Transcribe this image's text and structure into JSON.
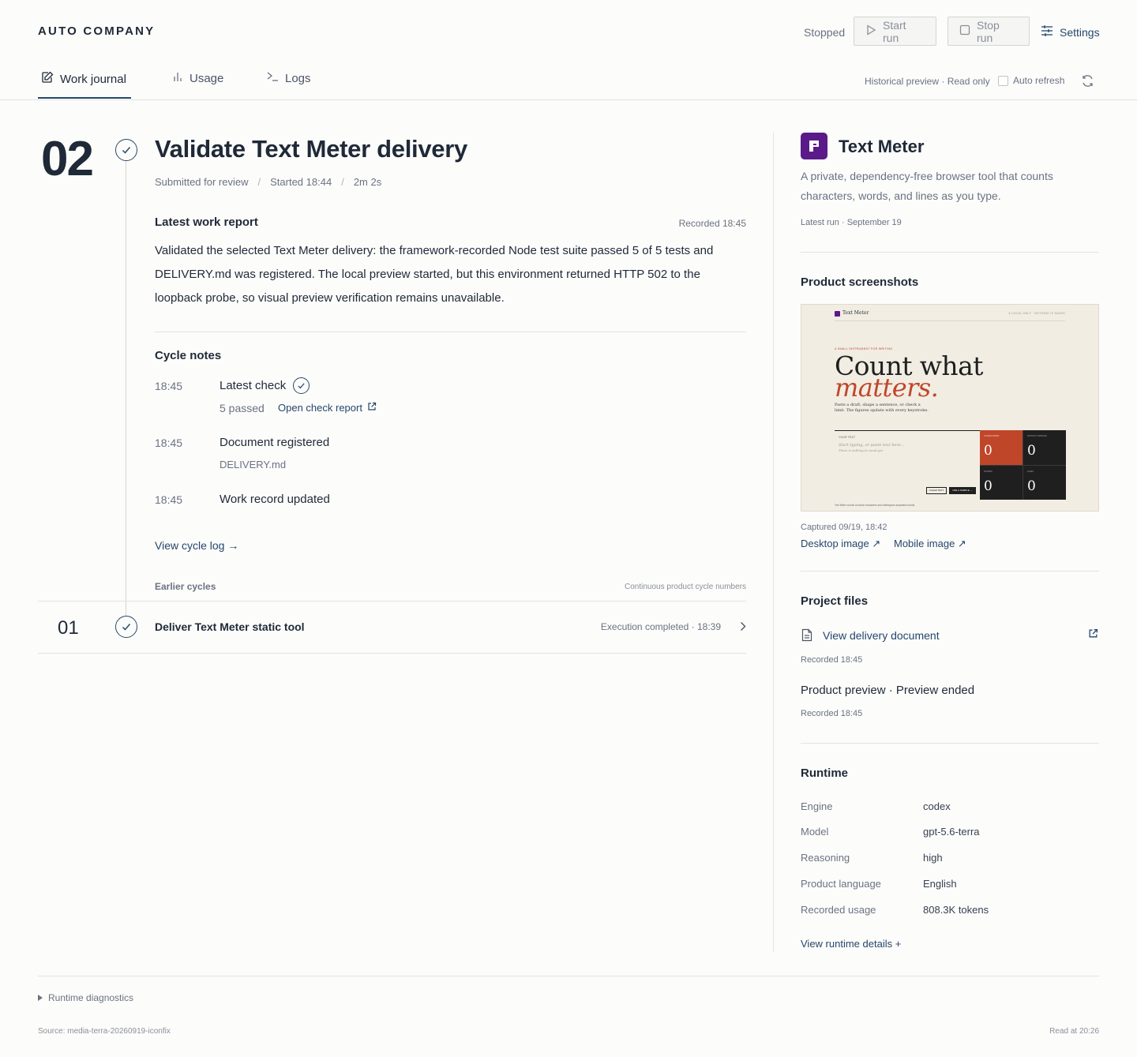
{
  "header": {
    "brand": "AUTO COMPANY",
    "status": "Stopped",
    "start_label": "Start run",
    "stop_label": "Stop run",
    "settings_label": "Settings"
  },
  "tabs": [
    {
      "label": "Work journal",
      "active": true
    },
    {
      "label": "Usage",
      "active": false
    },
    {
      "label": "Logs",
      "active": false
    }
  ],
  "toolbar": {
    "mode": "Historical preview · Read only",
    "auto_refresh_label": "Auto refresh",
    "auto_refresh_checked": false
  },
  "cycle": {
    "number": "02",
    "title": "Validate Text Meter delivery",
    "meta": [
      "Submitted for review",
      "Started 18:44",
      "2m 2s"
    ],
    "report_heading": "Latest work report",
    "report_recorded": "Recorded 18:45",
    "report_text": "Validated the selected Text Meter delivery: the framework-recorded Node test suite passed 5 of 5 tests and DELIVERY.md was registered. The local preview started, but this environment returned HTTP 502 to the loopback probe, so visual preview verification remains unavailable.",
    "notes_heading": "Cycle notes",
    "notes": [
      {
        "time": "18:45",
        "title": "Latest check",
        "sub": "5 passed",
        "link": "Open check report"
      },
      {
        "time": "18:45",
        "title": "Document registered",
        "sub": "DELIVERY.md"
      },
      {
        "time": "18:45",
        "title": "Work record updated"
      }
    ],
    "cycle_log_link": "View cycle log →"
  },
  "earlier": {
    "heading": "Earlier cycles",
    "note": "Continuous product cycle numbers",
    "items": [
      {
        "number": "01",
        "title": "Deliver Text Meter static tool",
        "status": "Execution completed · 18:39"
      }
    ]
  },
  "product": {
    "name": "Text Meter",
    "description": "A private, dependency-free browser tool that counts characters, words, and lines as you type.",
    "latest_run": "Latest run · September 19",
    "accent": "#5b1a8a"
  },
  "screenshots": {
    "heading": "Product screenshots",
    "captured": "Captured 09/19, 18:42",
    "desktop_link": "Desktop image ↗",
    "mobile_link": "Mobile image ↗",
    "preview": {
      "brand": "Text Meter",
      "topright": "● LOCAL ONLY · NOTHING IS SAVED",
      "kicker": "A SMALL INSTRUMENT FOR WRITING",
      "headline1": "Count what",
      "headline2": "matters.",
      "lead1": "Paste a draft, shape a sentence, or check a",
      "lead2": "limit. The figures update with every keystroke.",
      "panel_label": "YOUR TEXT",
      "placeholder1": "Start typing, or paste text here…",
      "placeholder2": "There is nothing to count yet.",
      "clear_btn": "CLEAR TEXT",
      "sample_btn": "USE A SAMPLE →",
      "footer": "Text Meter counts Unicode characters and whitespace-separated words.",
      "stats": [
        {
          "label": "CHARACTERS",
          "value": "0",
          "accent": true
        },
        {
          "label": "WITHOUT SPACES",
          "value": "0",
          "accent": false
        },
        {
          "label": "WORDS",
          "value": "0",
          "accent": false
        },
        {
          "label": "LINES",
          "value": "0",
          "accent": false
        }
      ]
    }
  },
  "files": {
    "heading": "Project files",
    "doc_link": "View delivery document",
    "doc_recorded": "Recorded 18:45",
    "preview_status": "Product preview · Preview ended",
    "preview_recorded": "Recorded 18:45"
  },
  "runtime": {
    "heading": "Runtime",
    "rows": [
      {
        "label": "Engine",
        "value": "codex"
      },
      {
        "label": "Model",
        "value": "gpt-5.6-terra"
      },
      {
        "label": "Reasoning",
        "value": "high"
      },
      {
        "label": "Product language",
        "value": "English"
      },
      {
        "label": "Recorded usage",
        "value": "808.3K tokens"
      }
    ],
    "details_link": "View runtime details +"
  },
  "footer": {
    "diagnostics": "Runtime diagnostics",
    "source": "Source: media-terra-20260919-iconfix",
    "read_at": "Read at 20:26"
  }
}
